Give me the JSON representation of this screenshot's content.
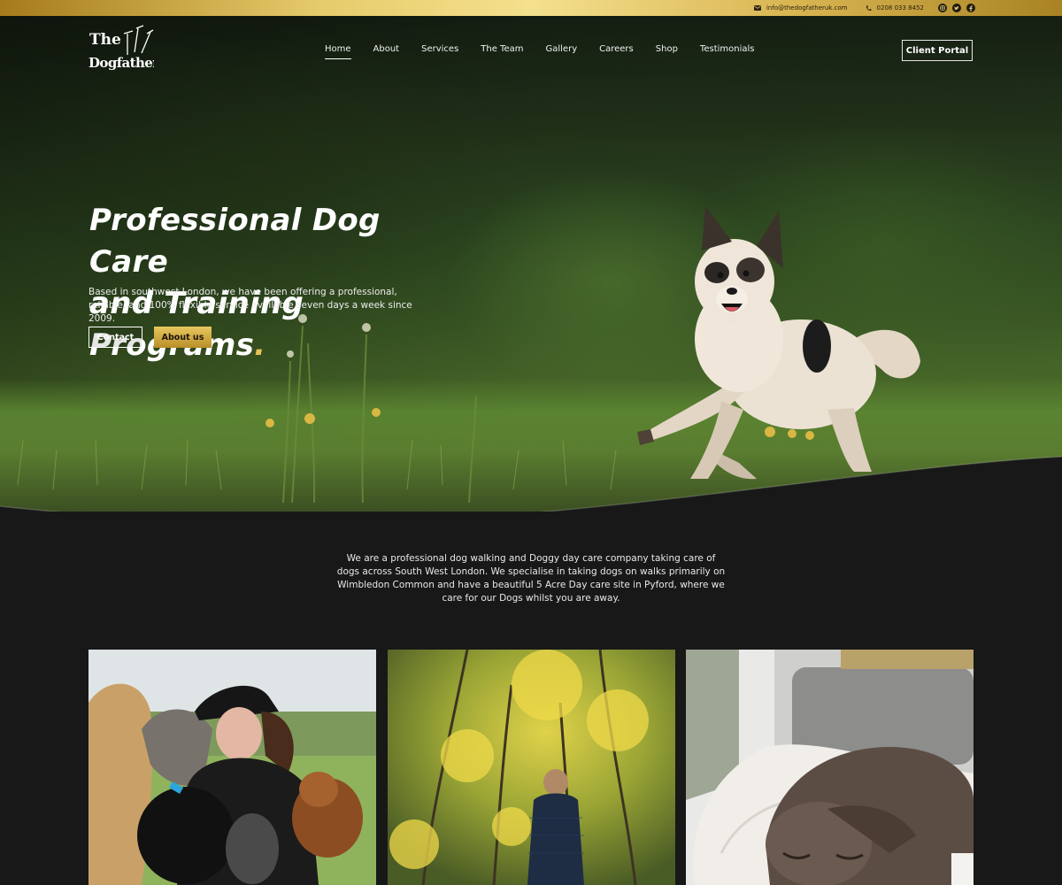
{
  "topbar": {
    "email": "info@thedogfatheruk.com",
    "phone": "0208 033 8452",
    "social": [
      "instagram-icon",
      "twitter-icon",
      "facebook-icon"
    ]
  },
  "brand": {
    "logo_line1": "The",
    "logo_line2": "Dogfather"
  },
  "nav": {
    "items": [
      {
        "label": "Home",
        "active": true
      },
      {
        "label": "About"
      },
      {
        "label": "Services"
      },
      {
        "label": "The Team"
      },
      {
        "label": "Gallery"
      },
      {
        "label": "Careers"
      },
      {
        "label": "Shop"
      },
      {
        "label": "Testimonials"
      }
    ],
    "portal_label": "Client Portal"
  },
  "hero": {
    "title_line1": "Professional Dog Care",
    "title_line2": "and Training Programs",
    "title_dot": ".",
    "subtitle": "Based in southwest London, we have been offering a professional, reliable, and 100% flexible service available seven days a week since 2009.",
    "contact_label": "Contact",
    "about_label": "About us"
  },
  "intro": {
    "text": "We are a professional dog walking and Doggy day care company taking care of dogs across South West London. We specialise in taking dogs on walks primarily on Wimbledon Common and have a beautiful 5 Acre Day care site in Pyford, where we care for our Dogs whilst you are away."
  },
  "colors": {
    "gold": "#e8c357",
    "background": "#181818"
  }
}
